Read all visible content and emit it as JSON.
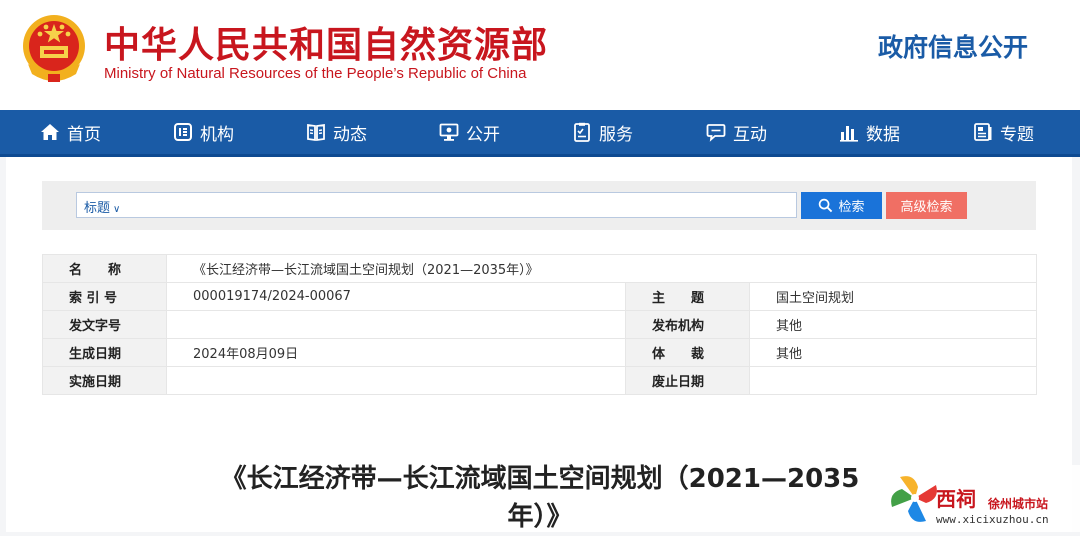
{
  "header": {
    "title": "中华人民共和国自然资源部",
    "subtitle": "Ministry of Natural Resources of the People’s Republic of China",
    "section": "政府信息公开",
    "emblem_icon": "national-emblem-icon"
  },
  "nav": {
    "items": [
      {
        "label": "首页",
        "icon": "home-icon"
      },
      {
        "label": "机构",
        "icon": "organization-icon"
      },
      {
        "label": "动态",
        "icon": "news-book-icon"
      },
      {
        "label": "公开",
        "icon": "monitor-icon"
      },
      {
        "label": "服务",
        "icon": "checklist-icon"
      },
      {
        "label": "互动",
        "icon": "chat-bubble-icon"
      },
      {
        "label": "数据",
        "icon": "bar-chart-icon"
      },
      {
        "label": "专题",
        "icon": "document-icon"
      }
    ]
  },
  "search": {
    "scope_label": "标题",
    "value": "",
    "search_button": "检索",
    "advanced_button": "高级检索"
  },
  "metadata": {
    "name_label": "名　　称",
    "name_value": "《长江经济带—长江流域国土空间规划（2021—2035年）》",
    "index_label": "索 引 号",
    "index_value": "000019174/2024-00067",
    "subject_label": "主　　题",
    "subject_value": "国土空间规划",
    "doc_no_label": "发文字号",
    "doc_no_value": "",
    "issuer_label": "发布机构",
    "issuer_value": "其他",
    "date_label": "生成日期",
    "date_value": "2024年08月09日",
    "genre_label": "体　　裁",
    "genre_value": "其他",
    "effective_label": "实施日期",
    "effective_value": "",
    "expiry_label": "废止日期",
    "expiry_value": ""
  },
  "document": {
    "title_line1": "《长江经济带—长江流域国土空间规划（2021—2035",
    "title_line2": "年）》"
  },
  "watermark": {
    "brand": "西祠",
    "city": "徐州城市站",
    "url": "www.xicixuzhou.cn"
  },
  "colors": {
    "brand_red": "#c8161e",
    "nav_blue": "#1a5ba6",
    "search_blue": "#1a73d9",
    "advanced_red": "#f06f64"
  }
}
